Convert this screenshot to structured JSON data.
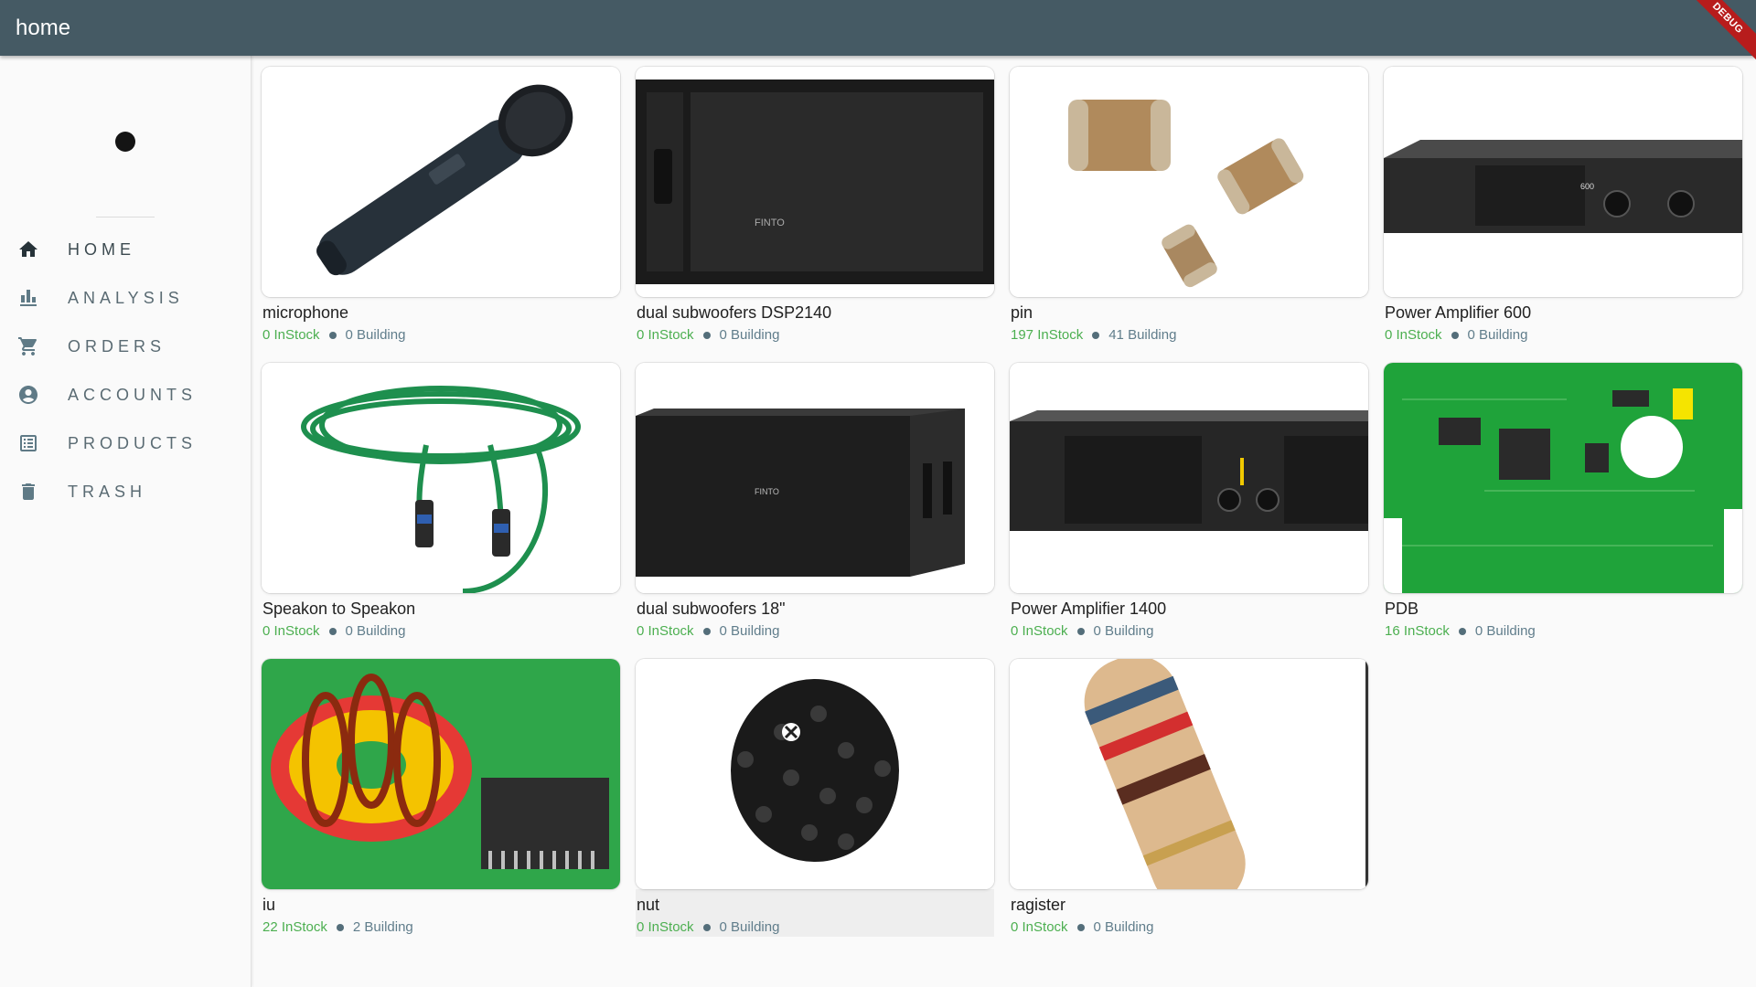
{
  "appbar": {
    "title": "home",
    "debug_label": "DEBUG"
  },
  "sidebar": {
    "items": [
      {
        "label": "HOME",
        "icon": "home-icon"
      },
      {
        "label": "ANALYSIS",
        "icon": "bar-chart-icon"
      },
      {
        "label": "ORDERS",
        "icon": "cart-icon"
      },
      {
        "label": "ACCOUNTS",
        "icon": "account-circle-icon"
      },
      {
        "label": "PRODUCTS",
        "icon": "list-icon"
      },
      {
        "label": "TRASH",
        "icon": "trash-icon"
      }
    ]
  },
  "products": [
    {
      "name": "microphone",
      "instock": "0 InStock",
      "building": "0 Building"
    },
    {
      "name": "dual subwoofers DSP2140",
      "instock": "0 InStock",
      "building": "0 Building"
    },
    {
      "name": "pin",
      "instock": "197 InStock",
      "building": "41 Building"
    },
    {
      "name": "Power Amplifier 600",
      "instock": "0 InStock",
      "building": "0 Building"
    },
    {
      "name": "Speakon to Speakon",
      "instock": "0 InStock",
      "building": "0 Building"
    },
    {
      "name": "dual subwoofers 18\"",
      "instock": "0 InStock",
      "building": "0 Building"
    },
    {
      "name": "Power Amplifier 1400",
      "instock": "0 InStock",
      "building": "0 Building"
    },
    {
      "name": "PDB",
      "instock": "16 InStock",
      "building": "0 Building"
    },
    {
      "name": "iu",
      "instock": "22 InStock",
      "building": "2 Building"
    },
    {
      "name": "nut",
      "instock": "0 InStock",
      "building": "0 Building"
    },
    {
      "name": "ragister",
      "instock": "0 InStock",
      "building": "0 Building"
    }
  ],
  "colors": {
    "appbar": "#455a64",
    "instock": "#4caf50",
    "building": "#607d8b"
  }
}
